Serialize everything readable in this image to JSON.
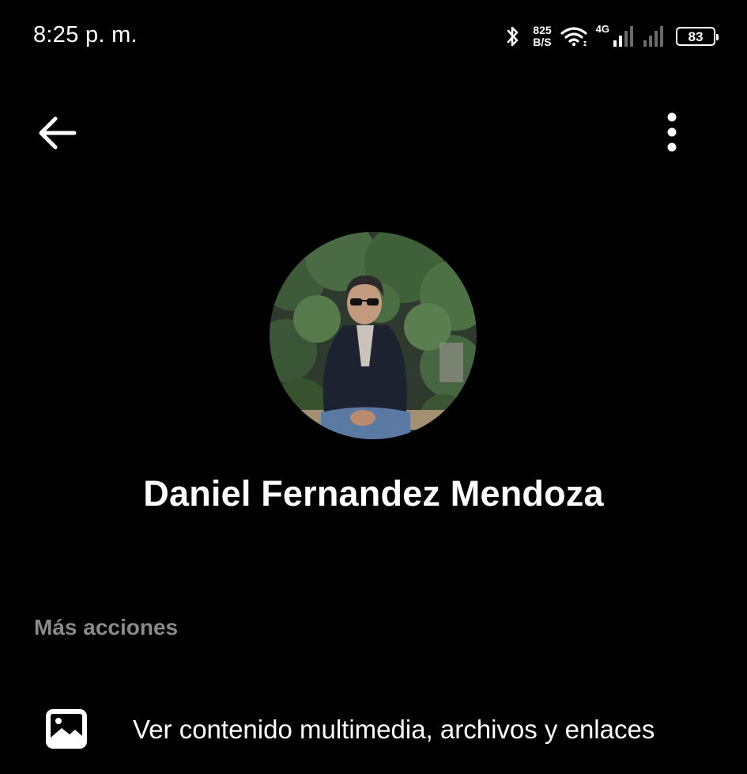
{
  "status_bar": {
    "time": "8:25 p. m.",
    "net_speed_value": "825",
    "net_speed_unit": "B/S",
    "network_type": "4G",
    "battery_level": "83",
    "icons": [
      "bluetooth-icon",
      "wifi-icon",
      "signal-icon",
      "signal-icon",
      "battery-icon"
    ]
  },
  "toolbar": {
    "back_icon": "arrow-left-icon",
    "more_icon": "more-vertical-icon"
  },
  "profile": {
    "name": "Daniel Fernandez Mendoza",
    "avatar_icon": "profile-photo"
  },
  "sections": {
    "more_actions_label": "Más acciones"
  },
  "actions": [
    {
      "icon": "image-icon",
      "label": "Ver contenido multimedia, archivos y enlaces"
    }
  ],
  "colors": {
    "background": "#000000",
    "text_primary": "#ffffff",
    "text_secondary": "#8a8a8a"
  }
}
